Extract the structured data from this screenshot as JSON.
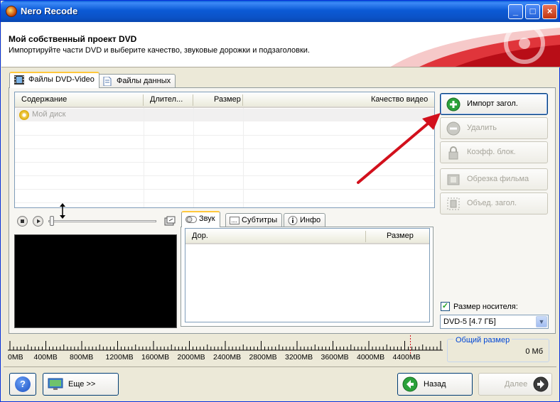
{
  "window": {
    "title": "Nero Recode",
    "controls": {
      "minimize": "_",
      "maximize": "□",
      "close": "×"
    }
  },
  "header": {
    "title": "Мой собственный проект DVD",
    "subtitle": "Импортируйте части DVD и выберите качество, звуковые дорожки и подзаголовки."
  },
  "tabs": [
    {
      "label": "Файлы DVD-Video",
      "icon": "film-icon",
      "active": true
    },
    {
      "label": "Файлы данных",
      "icon": "document-icon",
      "active": false
    }
  ],
  "grid": {
    "columns": [
      "Содержание",
      "Длител...",
      "Размер",
      "Качество видео"
    ],
    "rows": [
      {
        "content": "Мой диск",
        "icon": "disc-icon"
      }
    ]
  },
  "side_buttons": [
    {
      "label": "Импорт загол.",
      "icon": "add-icon",
      "enabled": true
    },
    {
      "label": "Удалить",
      "icon": "remove-icon",
      "enabled": false
    },
    {
      "label": "Коэфф. блок.",
      "icon": "lock-icon",
      "enabled": false
    },
    {
      "label": "Обрезка фильма",
      "icon": "film-cut-icon",
      "enabled": false
    },
    {
      "label": "Объед. загол.",
      "icon": "merge-icon",
      "enabled": false
    }
  ],
  "sub_tabs": [
    {
      "label": "Звук",
      "icon": "sound-toggle-icon",
      "active": true
    },
    {
      "label": "Субтитры",
      "icon": "subtitles-icon",
      "active": false
    },
    {
      "label": "Инфо",
      "icon": "info-icon",
      "active": false
    }
  ],
  "sub_grid": {
    "columns": [
      "Дор.",
      "Размер"
    ]
  },
  "media": {
    "size_checkbox_label": "Размер носителя:",
    "size_checked": true,
    "selected_media": "DVD-5 [4.7 ГБ]"
  },
  "ruler": {
    "labels": [
      "0MB",
      "400MB",
      "800MB",
      "1200MB",
      "1600MB",
      "2000MB",
      "2400MB",
      "2800MB",
      "3200MB",
      "3600MB",
      "4000MB",
      "4400MB"
    ],
    "used_mb": 0
  },
  "total_size": {
    "title": "Общий размер",
    "value": "0 Мб"
  },
  "footer": {
    "help_label": "?",
    "more_label": "Еще >>",
    "back_label": "Назад",
    "next_label": "Далее"
  },
  "colors": {
    "accent_red": "#d2101c",
    "title_blue": "#0b5ad6",
    "link_blue": "#0046d5"
  }
}
